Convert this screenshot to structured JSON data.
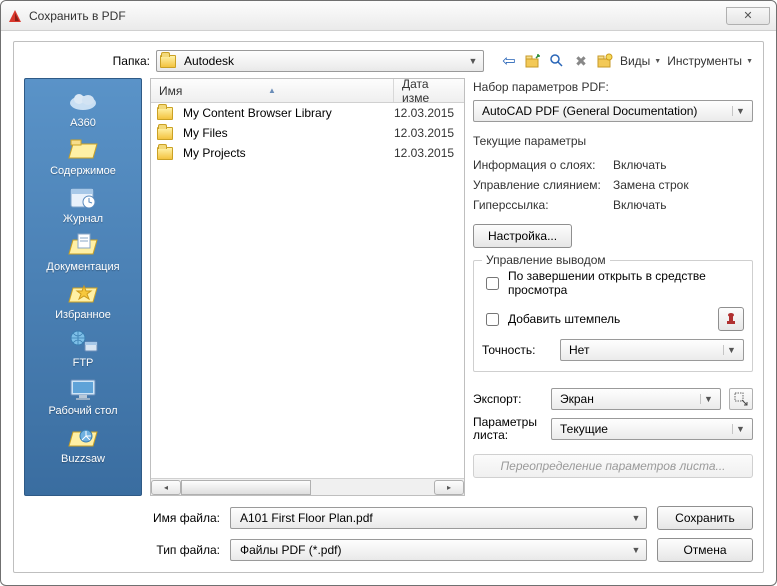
{
  "window": {
    "title": "Сохранить в PDF",
    "close_glyph": "✕"
  },
  "toolbar": {
    "folder_label": "Папка:",
    "folder_value": "Autodesk",
    "views_label": "Виды",
    "tools_label": "Инструменты"
  },
  "places": [
    {
      "label": "A360"
    },
    {
      "label": "Содержимое"
    },
    {
      "label": "Журнал"
    },
    {
      "label": "Документация"
    },
    {
      "label": "Избранное"
    },
    {
      "label": "FTP"
    },
    {
      "label": "Рабочий стол"
    },
    {
      "label": "Buzzsaw"
    }
  ],
  "filelist": {
    "col_name": "Имя",
    "col_date": "Дата изме",
    "rows": [
      {
        "name": "My Content Browser Library",
        "date": "12.03.2015"
      },
      {
        "name": "My Files",
        "date": "12.03.2015"
      },
      {
        "name": "My Projects",
        "date": "12.03.2015"
      }
    ]
  },
  "right": {
    "preset_label": "Набор параметров PDF:",
    "preset_value": "AutoCAD PDF (General Documentation)",
    "current_label": "Текущие параметры",
    "layer_k": "Информация о слоях:",
    "layer_v": "Включать",
    "merge_k": "Управление слиянием:",
    "merge_v": "Замена строк",
    "link_k": "Гиперссылка:",
    "link_v": "Включать",
    "settings_btn": "Настройка...",
    "output_group": "Управление выводом",
    "open_after": "По завершении открыть в средстве просмотра",
    "add_stamp": "Добавить штемпель",
    "precision_label": "Точность:",
    "precision_value": "Нет",
    "export_label": "Экспорт:",
    "export_value": "Экран",
    "sheet_label": "Параметры листа:",
    "sheet_value": "Текущие",
    "override": "Переопределение параметров листа..."
  },
  "bottom": {
    "filename_label": "Имя файла:",
    "filename_value": "A101 First Floor Plan.pdf",
    "filetype_label": "Тип файла:",
    "filetype_value": "Файлы PDF (*.pdf)",
    "save": "Сохранить",
    "cancel": "Отмена"
  }
}
